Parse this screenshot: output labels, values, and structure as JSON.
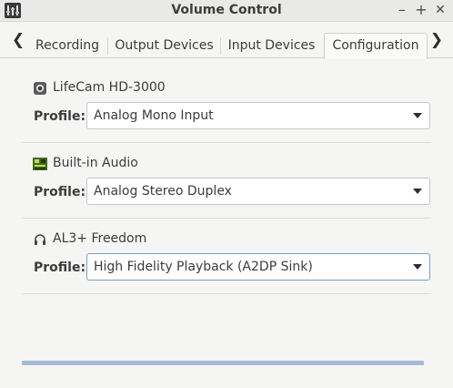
{
  "window": {
    "title": "Volume Control"
  },
  "window_buttons": {
    "minimize": "–",
    "maximize": "+",
    "close": "✕"
  },
  "tabs": [
    {
      "label": "Recording"
    },
    {
      "label": "Output Devices"
    },
    {
      "label": "Input Devices"
    },
    {
      "label": "Configuration"
    }
  ],
  "active_tab": "Configuration",
  "devices": [
    {
      "name": "LifeCam HD-3000",
      "icon": "webcam-icon",
      "profile_label": "Profile:",
      "profile": "Analog Mono Input"
    },
    {
      "name": "Built-in Audio",
      "icon": "sound-card-icon",
      "profile_label": "Profile:",
      "profile": "Analog Stereo Duplex"
    },
    {
      "name": "AL3+ Freedom",
      "icon": "headphones-icon",
      "profile_label": "Profile:",
      "profile": "High Fidelity Playback (A2DP Sink)"
    }
  ],
  "colors": {
    "accent": "#7f9cc6",
    "progress": "#a7bad6"
  }
}
